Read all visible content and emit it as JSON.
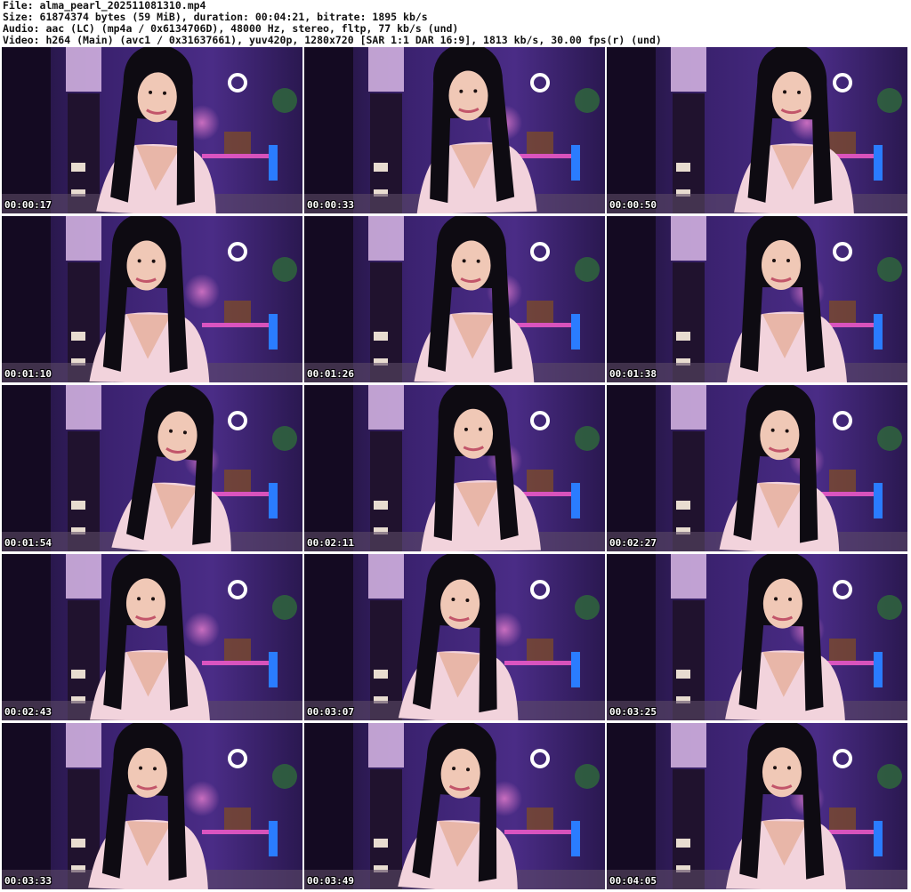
{
  "header": {
    "file_line": "File: alma_pearl_202511081310.mp4",
    "size_line": "Size: 61874374 bytes (59 MiB), duration: 00:04:21, bitrate: 1895 kb/s",
    "audio_line": "Audio: aac (LC) (mp4a / 0x6134706D), 48000 Hz, stereo, fltp, 77 kb/s (und)",
    "video_line": "Video: h264 (Main) (avc1 / 0x31637661), yuv420p, 1280x720 [SAR 1:1 DAR 16:9], 1813 kb/s, 30.00 fps(r) (und)"
  },
  "thumbnails": [
    {
      "timestamp": "00:00:17"
    },
    {
      "timestamp": "00:00:33"
    },
    {
      "timestamp": "00:00:50"
    },
    {
      "timestamp": "00:01:10"
    },
    {
      "timestamp": "00:01:26"
    },
    {
      "timestamp": "00:01:38"
    },
    {
      "timestamp": "00:01:54"
    },
    {
      "timestamp": "00:02:11"
    },
    {
      "timestamp": "00:02:27"
    },
    {
      "timestamp": "00:02:43"
    },
    {
      "timestamp": "00:03:07"
    },
    {
      "timestamp": "00:03:25"
    },
    {
      "timestamp": "00:03:33"
    },
    {
      "timestamp": "00:03:49"
    },
    {
      "timestamp": "00:04:05"
    }
  ],
  "colors": {
    "background": "#ffffff",
    "scene_purple": "#3a1f6e",
    "robe_pink": "#f2d3dc",
    "hair_black": "#0e0b12",
    "ring_light": "#ffffff",
    "led_blue": "#2a7cff"
  }
}
